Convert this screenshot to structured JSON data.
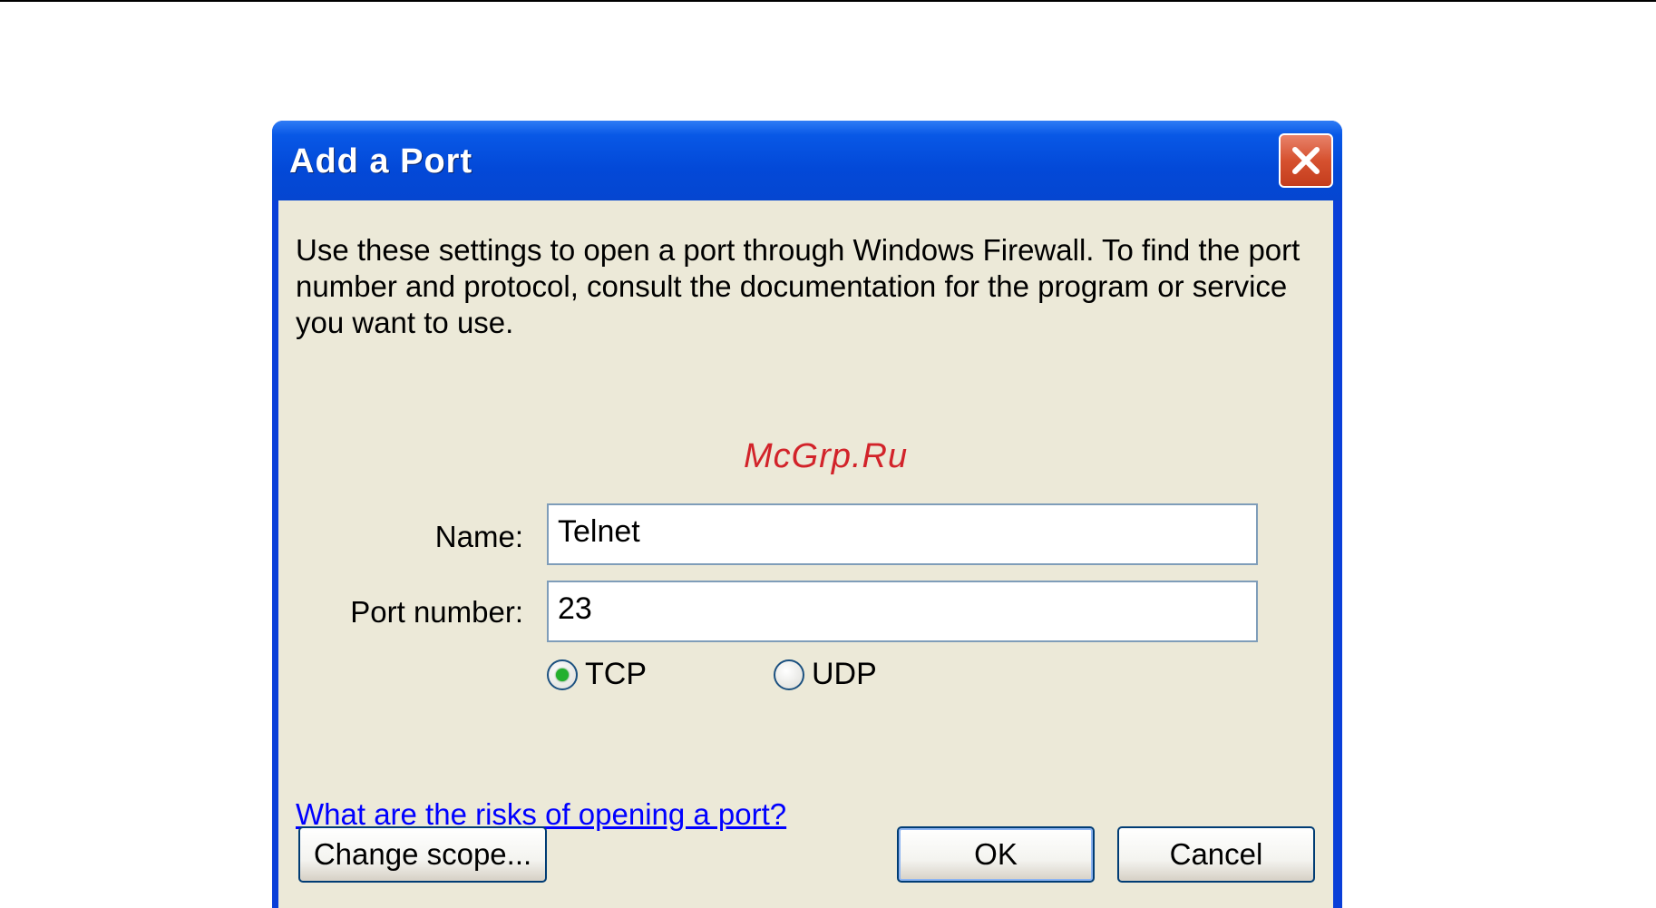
{
  "dialog": {
    "title": "Add a Port",
    "intro": "Use these settings to open a port through Windows Firewall. To find the port number and protocol, consult the documentation for the program or service you want to use.",
    "name_label": "Name:",
    "name_value": "Telnet",
    "port_label": "Port number:",
    "port_value": "23",
    "protocols": [
      {
        "label": "TCP",
        "selected": true
      },
      {
        "label": "UDP",
        "selected": false
      }
    ],
    "help_link": "What are the risks of opening a port?",
    "buttons": {
      "change_scope": "Change scope...",
      "ok": "OK",
      "cancel": "Cancel"
    }
  },
  "watermark": "McGrp.Ru",
  "icons": {
    "close": "close-icon"
  },
  "colors": {
    "titlebar": "#0349d8",
    "client": "#ece9d8",
    "close_button": "#d6512f",
    "link": "#0000ff",
    "radio_selected": "#23b02d",
    "watermark": "#d2232a"
  }
}
